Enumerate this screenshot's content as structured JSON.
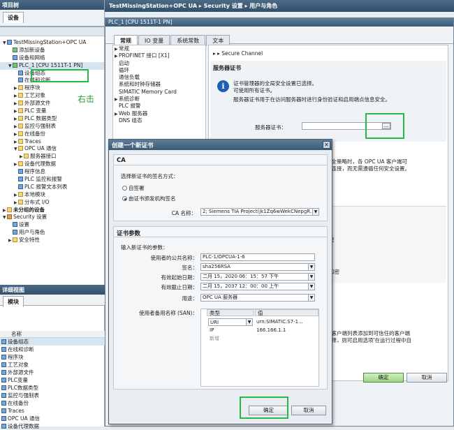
{
  "project_tree": {
    "header": "项目树",
    "tab": "设备",
    "items": [
      {
        "label": "TestMissingStation+OPC UA",
        "indent": 0,
        "tw": "▼",
        "ic": "b"
      },
      {
        "label": "添加新设备",
        "indent": 1,
        "tw": "",
        "ic": "g"
      },
      {
        "label": "设备和网络",
        "indent": 1,
        "tw": "",
        "ic": "b"
      },
      {
        "label": "PLC_1 [CPU 1511T-1 PN]",
        "indent": 1,
        "tw": "▼",
        "ic": "g",
        "sel": true
      },
      {
        "label": "设备组态",
        "indent": 2,
        "tw": "",
        "ic": "b"
      },
      {
        "label": "在线和诊断",
        "indent": 2,
        "tw": "",
        "ic": "b"
      },
      {
        "label": "程序块",
        "indent": 2,
        "tw": "▶",
        "ic": "f"
      },
      {
        "label": "工艺对象",
        "indent": 2,
        "tw": "▶",
        "ic": "f"
      },
      {
        "label": "外部源文件",
        "indent": 2,
        "tw": "▶",
        "ic": "f"
      },
      {
        "label": "PLC 变量",
        "indent": 2,
        "tw": "▶",
        "ic": "f"
      },
      {
        "label": "PLC 数据类型",
        "indent": 2,
        "tw": "▶",
        "ic": "f"
      },
      {
        "label": "监控与强制表",
        "indent": 2,
        "tw": "▶",
        "ic": "f"
      },
      {
        "label": "在线备份",
        "indent": 2,
        "tw": "▶",
        "ic": "f"
      },
      {
        "label": "Traces",
        "indent": 2,
        "tw": "▶",
        "ic": "f"
      },
      {
        "label": "OPC UA 通信",
        "indent": 2,
        "tw": "▼",
        "ic": "f"
      },
      {
        "label": "服务器接口",
        "indent": 3,
        "tw": "▶",
        "ic": "f"
      },
      {
        "label": "设备代理数据",
        "indent": 2,
        "tw": "▶",
        "ic": "f"
      },
      {
        "label": "程序信息",
        "indent": 2,
        "tw": "",
        "ic": "b"
      },
      {
        "label": "PLC 监控和报警",
        "indent": 2,
        "tw": "",
        "ic": "b"
      },
      {
        "label": "PLC 报警文本列表",
        "indent": 2,
        "tw": "",
        "ic": "b"
      },
      {
        "label": "本地模块",
        "indent": 2,
        "tw": "▶",
        "ic": "f"
      },
      {
        "label": "分布式 I/O",
        "indent": 2,
        "tw": "▶",
        "ic": "f"
      },
      {
        "label": "未分组的设备",
        "indent": 0,
        "tw": "▶",
        "ic": "f",
        "bold": true
      },
      {
        "label": "Security 设置",
        "indent": 0,
        "tw": "▼",
        "ic": "r"
      },
      {
        "label": "设置",
        "indent": 1,
        "tw": "",
        "ic": "b"
      },
      {
        "label": "用户与角色",
        "indent": 1,
        "tw": "",
        "ic": "b"
      },
      {
        "label": "安全特性",
        "indent": 1,
        "tw": "▶",
        "ic": "f"
      }
    ],
    "annotation": "右击"
  },
  "detail_view": {
    "header": "详细视图",
    "tab": "模块",
    "column": "名称",
    "items": [
      "设备组态",
      "在线和诊断",
      "程序块",
      "工艺对象",
      "外部源文件",
      "PLC变量",
      "PLC数据类型",
      "监控与强制表",
      "在线备份",
      "Traces",
      "OPC UA 通信",
      "设备代理数据"
    ]
  },
  "breadcrumb": "TestMissingStation+OPC UA ▸ Security 设置 ▸ 用户与角色",
  "properties": {
    "title": "PLC_1 [CPU 1511T-1 PN]",
    "tabs": [
      "常规",
      "IO 变量",
      "系统常数",
      "文本"
    ],
    "nav": [
      {
        "label": "常规",
        "tw": "▶"
      },
      {
        "label": "PROFINET 接口 [X1]",
        "tw": "▶"
      },
      {
        "label": "启动",
        "tw": ""
      },
      {
        "label": "循环",
        "tw": ""
      },
      {
        "label": "通信负载",
        "tw": ""
      },
      {
        "label": "系统和时钟存储器",
        "tw": ""
      },
      {
        "label": "SIMATIC Memory Card",
        "tw": ""
      },
      {
        "label": "系统诊断",
        "tw": "▶"
      },
      {
        "label": "PLC 报警",
        "tw": ""
      },
      {
        "label": "Web 服务器",
        "tw": "▶"
      },
      {
        "label": "DNS 组态",
        "tw": ""
      }
    ],
    "breadcrumb": "▸ ▸  Secure Channel",
    "server_cert_header": "服务器证书",
    "info1": "证书管理器的全局安全设置已选择。",
    "info2": "可使用所有证书。",
    "info3": "服务器证书用于在访问服务器时进行身份验证和启用端点信息安全。",
    "server_cert_label": "服务器证书：",
    "browse": "...",
    "partial": [
      "安全策略时，各 OPC UA 客户端可",
      "行连接，而无需遵循任何安全设置。"
    ],
    "partial2": [
      "密",
      "加密"
    ],
    "partial3": [
      "任客户端列表添加到可信任的客户端",
      "选择，则可启用选项'在运行过程中自"
    ],
    "ok": "确定",
    "cancel": "取消"
  },
  "dialog": {
    "title": "创建一个新证书",
    "close": "✕",
    "ca_header": "CA",
    "ca_prompt": "选择新证书的签名方式：",
    "radio_self": "自签署",
    "radio_ca": "由证书颁发机构签名",
    "ca_name_label": "CA 名称：",
    "ca_name_value": "2; Siemens TIA Project(jk1Zq6wWekCNepgR...",
    "params_header": "证书参数",
    "params_prompt": "输入新证书的参数：",
    "fields": [
      {
        "label": "使用者的公共名称：",
        "value": "PLC-1/OPCUA-1-6",
        "dd": false
      },
      {
        "label": "签名：",
        "value": "sha256RSA",
        "dd": true
      },
      {
        "label": "有效起始日期：",
        "value": "二月 15，2020 06：15：57 下午",
        "dd": true
      },
      {
        "label": "有效截止日期：",
        "value": "二月 15，2037 12：00：00 上午",
        "dd": true
      },
      {
        "label": "用途：",
        "value": "OPC UA 服务器",
        "dd": true
      }
    ],
    "san_label": "使用者备用名称 (SAN)：",
    "san_cols": [
      "类型",
      "值"
    ],
    "san_rows": [
      {
        "type": "URI",
        "value": "urn:SIMATIC.S7-1..."
      },
      {
        "type": "IP",
        "value": "166.166.1.1"
      },
      {
        "type": "新增",
        "value": ""
      }
    ],
    "ok": "确定",
    "cancel": "取消"
  }
}
